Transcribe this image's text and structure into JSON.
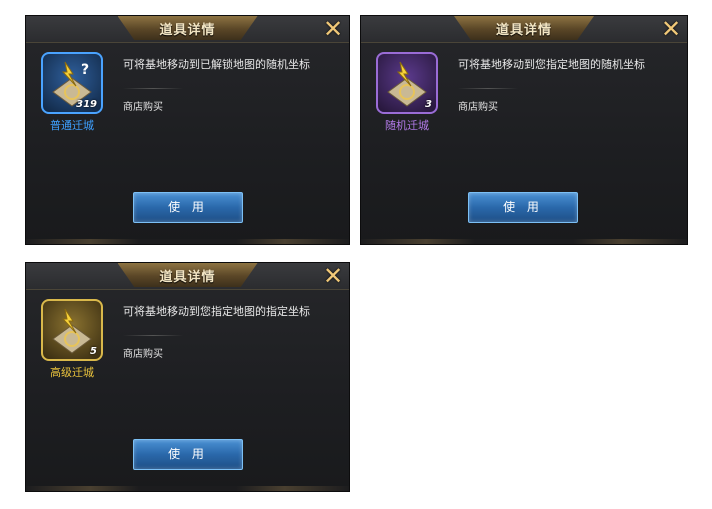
{
  "panels": [
    {
      "title": "道具详情",
      "item_name": "普通迁城",
      "count": "319",
      "description": "可将基地移动到已解锁地图的随机坐标",
      "source": "商店购买",
      "use_label": "使 用",
      "rarity_color": "#3ea0ff"
    },
    {
      "title": "道具详情",
      "item_name": "随机迁城",
      "count": "3",
      "description": "可将基地移动到您指定地图的随机坐标",
      "source": "商店购买",
      "use_label": "使 用",
      "rarity_color": "#b27ae8"
    },
    {
      "title": "道具详情",
      "item_name": "高级迁城",
      "count": "5",
      "description": "可将基地移动到您指定地图的指定坐标",
      "source": "商店购买",
      "use_label": "使 用",
      "rarity_color": "#e8c23c"
    }
  ],
  "close_glyph": "✕"
}
